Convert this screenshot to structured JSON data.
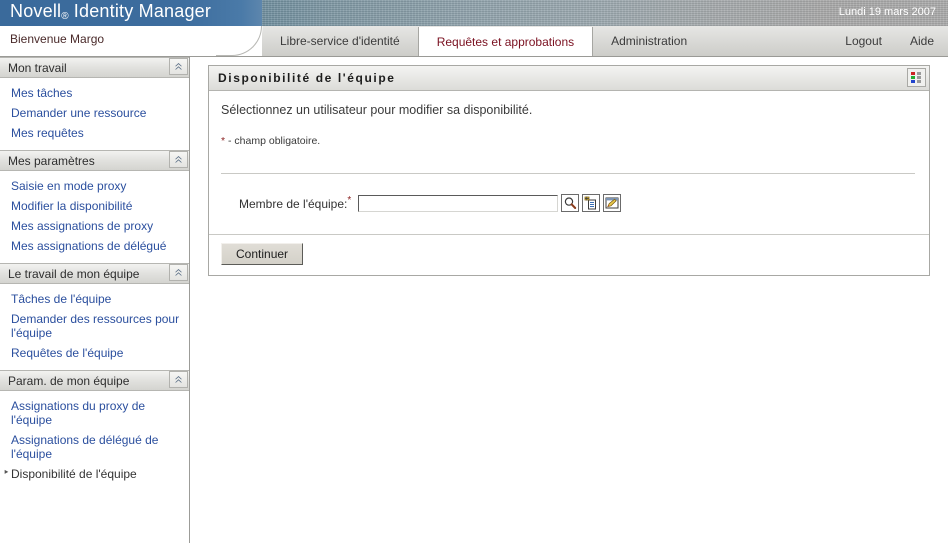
{
  "header": {
    "brand_novell": "Novell",
    "brand_reg": "®",
    "brand_product": "Identity Manager",
    "date": "Lundi 19 mars 2007",
    "brand_blue": "#3d6d9e"
  },
  "tabstrip": {
    "welcome": "Bienvenue Margo",
    "tabs": [
      {
        "label": "Libre-service d'identité",
        "active": false
      },
      {
        "label": "Requêtes et approbations",
        "active": true
      },
      {
        "label": "Administration",
        "active": false
      }
    ],
    "links": [
      {
        "label": "Logout"
      },
      {
        "label": "Aide"
      }
    ],
    "active_tab_color": "#7a1020"
  },
  "sidebar": {
    "groups": [
      {
        "header": "Mon travail",
        "collapse_icon": "chevron-double-up-icon",
        "items": [
          {
            "label": "Mes tâches",
            "selected": false
          },
          {
            "label": "Demander une ressource",
            "selected": false
          },
          {
            "label": "Mes requêtes",
            "selected": false
          }
        ]
      },
      {
        "header": "Mes paramètres",
        "collapse_icon": "chevron-double-up-icon",
        "items": [
          {
            "label": "Saisie en mode proxy",
            "selected": false
          },
          {
            "label": "Modifier la disponibilité",
            "selected": false
          },
          {
            "label": "Mes assignations de proxy",
            "selected": false
          },
          {
            "label": "Mes assignations de délégué",
            "selected": false
          }
        ]
      },
      {
        "header": "Le travail de mon équipe",
        "collapse_icon": "chevron-double-up-icon",
        "items": [
          {
            "label": "Tâches de l'équipe",
            "selected": false
          },
          {
            "label": "Demander des ressources pour l'équipe",
            "selected": false
          },
          {
            "label": "Requêtes de l'équipe",
            "selected": false
          }
        ]
      },
      {
        "header": "Param. de mon équipe",
        "collapse_icon": "chevron-double-up-icon",
        "items": [
          {
            "label": "Assignations du proxy de l'équipe",
            "selected": false
          },
          {
            "label": "Assignations de délégué de l'équipe",
            "selected": false
          },
          {
            "label": "Disponibilité de l'équipe",
            "selected": true
          }
        ]
      }
    ],
    "link_color": "#2b4f9e"
  },
  "panel": {
    "title": "Disponibilité de l'équipe",
    "header_icon": "color-grid-icon",
    "intro": "Sélectionnez un utilisateur pour modifier sa disponibilité.",
    "required_star": "*",
    "required_note": " - champ obligatoire.",
    "form": {
      "label": "Membre de l'équipe:",
      "label_star": "*",
      "input_value": "",
      "input_placeholder": "",
      "buttons": [
        {
          "icon": "search-magnifier-icon",
          "name": "object-lookup-button"
        },
        {
          "icon": "history-list-icon",
          "name": "object-history-button"
        },
        {
          "icon": "edit-pencil-icon",
          "name": "object-edit-button"
        }
      ]
    },
    "submit_label": "Continuer"
  }
}
